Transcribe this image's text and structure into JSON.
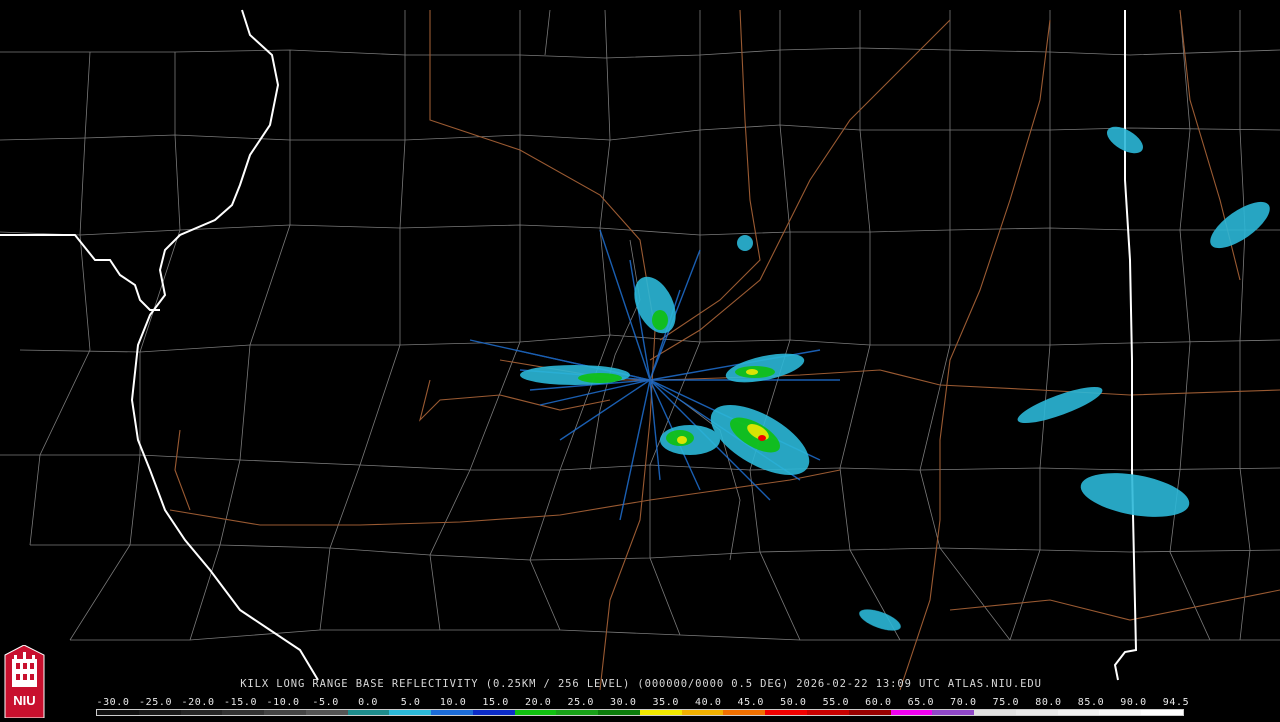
{
  "product": {
    "caption": "KILX LONG RANGE BASE REFLECTIVITY (0.25KM / 256 LEVEL) (000000/0000 0.5 DEG) 2026-02-22 13:09 UTC  ATLAS.NIU.EDU",
    "station": "KILX",
    "valid_time": "2026-02-22 13:09 UTC",
    "source": "ATLAS.NIU.EDU"
  },
  "logo": {
    "text": "NIU",
    "bg_color": "#c8102e"
  },
  "legend": {
    "ticks": [
      "-30.0",
      "-25.0",
      "-20.0",
      "-15.0",
      "-10.0",
      "-5.0",
      "0.0",
      "5.0",
      "10.0",
      "15.0",
      "20.0",
      "25.0",
      "30.0",
      "35.0",
      "40.0",
      "45.0",
      "50.0",
      "55.0",
      "60.0",
      "65.0",
      "70.0",
      "75.0",
      "80.0",
      "85.0",
      "90.0",
      "94.5"
    ],
    "colors": [
      "#101010",
      "#1a1a1a",
      "#262626",
      "#333333",
      "#444444",
      "#555555",
      "#1e8c8c",
      "#2cb8d8",
      "#1c6cd8",
      "#0c2cc8",
      "#10c010",
      "#18a018",
      "#0c7c0c",
      "#f0e800",
      "#f0b000",
      "#f07000",
      "#f00000",
      "#c80000",
      "#980000",
      "#f000f0",
      "#9048c8",
      "#e0e0e0",
      "#e8e8e8",
      "#f0f0f0",
      "#f8f8f8",
      "#ffffff"
    ]
  },
  "map": {
    "state_border_color": "#ffffff",
    "county_line_color": "#8a8a8a",
    "highway_color": "#9a5a32"
  }
}
